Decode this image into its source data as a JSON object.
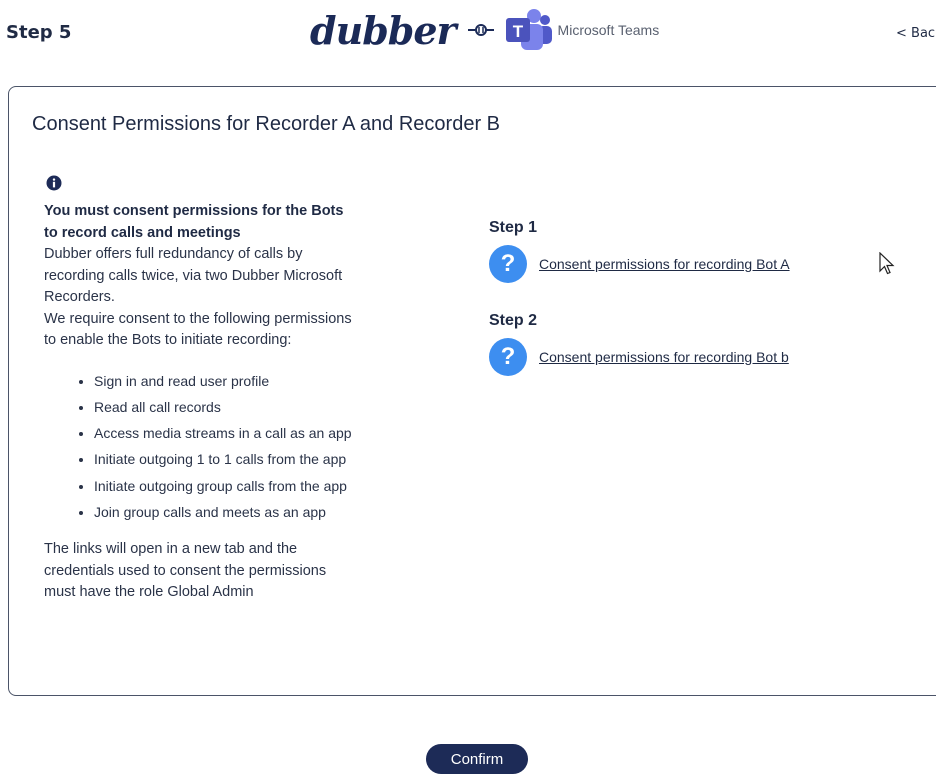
{
  "header": {
    "step": "Step 5",
    "brand_logo": "dubber",
    "partner_name": "Microsoft Teams",
    "back_label": "< Back"
  },
  "card": {
    "title": "Consent Permissions for Recorder A and Recorder B",
    "info_heading": "You must consent permissions for the Bots to record calls and meetings",
    "intro_1": "Dubber offers full redundancy of calls by recording calls twice, via two Dubber Microsoft Recorders.",
    "intro_2": "We require consent to the following permissions to enable the Bots to initiate recording:",
    "permissions": [
      "Sign in and read user profile",
      "Read all call records",
      "Access media streams in a call as an app",
      "Initiate outgoing 1 to 1 calls from the app",
      "Initiate outgoing group calls from the app",
      "Join group calls and meets as an app"
    ],
    "footer_note": "The links will open in a new tab and the credentials used to consent the permissions must have the role Global Admin"
  },
  "steps": [
    {
      "title": "Step 1",
      "link": "Consent permissions for recording Bot A"
    },
    {
      "title": "Step 2",
      "link": "Consent permissions for recording Bot b"
    }
  ],
  "confirm_label": "Confirm",
  "colors": {
    "primary": "#1d2b57",
    "accent": "#3d8ef0",
    "teams": "#5b5fc7"
  }
}
